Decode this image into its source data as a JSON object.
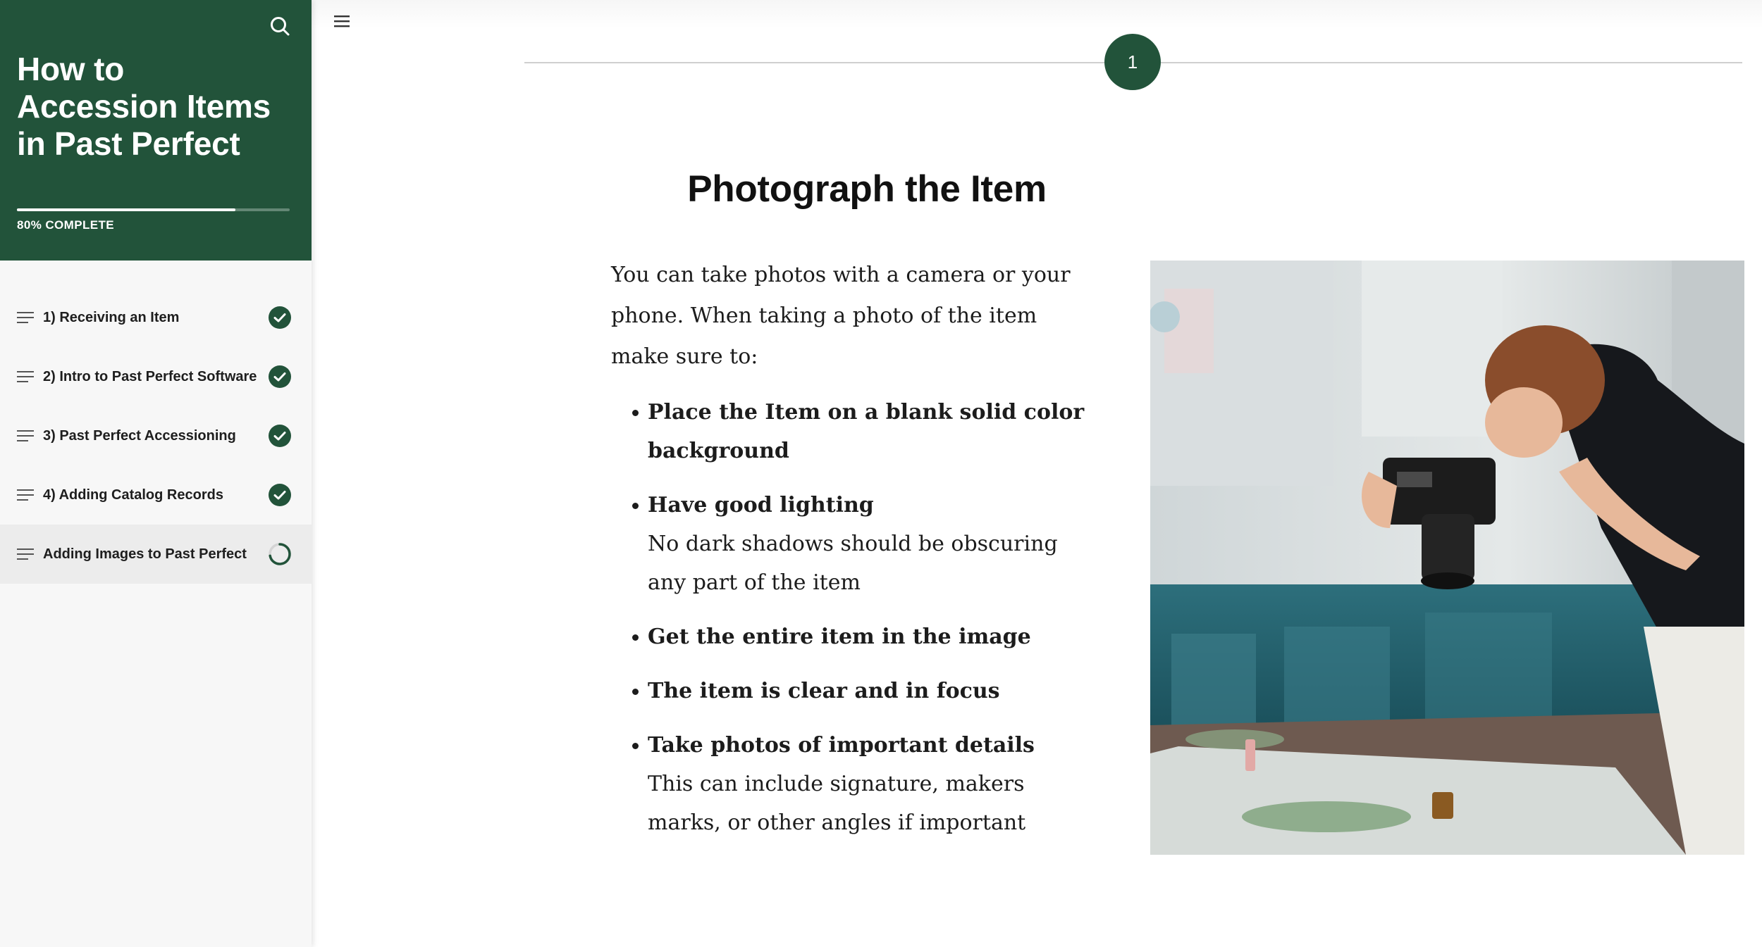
{
  "sidebar": {
    "course_title": "How to Accession Items in Past Perfect",
    "progress_label": "80% COMPLETE",
    "progress_fraction": 0.8,
    "lessons": [
      {
        "label": "1) Receiving an Item",
        "status": "complete"
      },
      {
        "label": "2) Intro to Past Perfect Software",
        "status": "complete"
      },
      {
        "label": "3) Past Perfect Accessioning",
        "status": "complete"
      },
      {
        "label": "4) Adding Catalog Records",
        "status": "complete"
      },
      {
        "label": "Adding Images to Past Perfect",
        "status": "in-progress"
      }
    ]
  },
  "main": {
    "step_number": "1",
    "title": "Photograph the Item",
    "intro": "You can take photos with a camera or your phone. When taking a photo of the item make sure to:",
    "bullets": [
      {
        "title": "Place the Item on a blank solid color background",
        "desc": ""
      },
      {
        "title": "Have good lighting",
        "desc": "No dark shadows should be obscuring any part of the item"
      },
      {
        "title": "Get the entire item in the image",
        "desc": ""
      },
      {
        "title": "The item is clear and in focus",
        "desc": ""
      },
      {
        "title": "Take photos of important details",
        "desc": "This can include signature, makers marks, or other angles if important"
      }
    ]
  },
  "colors": {
    "brand_green": "#22533a",
    "sidebar_bg": "#f7f7f7",
    "active_item_bg": "#ececec"
  },
  "icons": {
    "search": "search-icon",
    "menu": "hamburger-menu-icon",
    "lesson": "list-lines-icon",
    "complete": "check-circle-icon",
    "in_progress": "progress-ring-icon"
  }
}
